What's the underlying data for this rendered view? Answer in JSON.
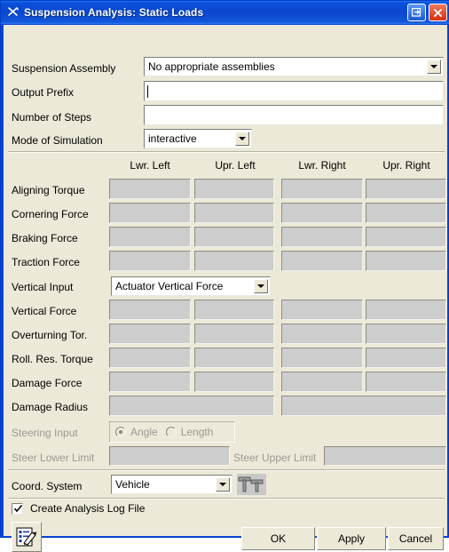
{
  "window": {
    "title": "Suspension Analysis: Static Loads",
    "app_icon": "scissors-icon",
    "buttons": [
      {
        "name": "restore-button",
        "icon": "restore-icon"
      },
      {
        "name": "close-button",
        "icon": "close-icon"
      }
    ],
    "titlebar_color": "#0a46cd",
    "client_color": "#ece9d8"
  },
  "form": {
    "suspension_assembly": {
      "label": "Suspension Assembly",
      "value": "No appropriate assemblies"
    },
    "output_prefix": {
      "label": "Output Prefix",
      "value": ""
    },
    "number_of_steps": {
      "label": "Number of Steps",
      "value": ""
    },
    "mode_of_simulation": {
      "label": "Mode of Simulation",
      "value": "interactive"
    }
  },
  "table": {
    "columns": [
      "Lwr. Left",
      "Upr. Left",
      "Lwr. Right",
      "Upr. Right"
    ],
    "rows": [
      {
        "label": "Aligning Torque",
        "values": [
          "",
          "",
          "",
          ""
        ]
      },
      {
        "label": "Cornering Force",
        "values": [
          "",
          "",
          "",
          ""
        ]
      },
      {
        "label": "Braking Force",
        "values": [
          "",
          "",
          "",
          ""
        ]
      },
      {
        "label": "Traction Force",
        "values": [
          "",
          "",
          "",
          ""
        ]
      },
      {
        "label": "Vertical Force",
        "values": [
          "",
          "",
          "",
          ""
        ]
      },
      {
        "label": "Overturning Tor.",
        "values": [
          "",
          "",
          "",
          ""
        ]
      },
      {
        "label": "Roll. Res. Torque",
        "values": [
          "",
          "",
          "",
          ""
        ]
      },
      {
        "label": "Damage Force",
        "values": [
          "",
          "",
          "",
          ""
        ]
      },
      {
        "label": "Damage Radius",
        "values": [
          "",
          ""
        ]
      }
    ]
  },
  "vertical_input": {
    "label": "Vertical Input",
    "value": "Actuator Vertical Force"
  },
  "steering": {
    "label": "Steering Input",
    "options": [
      {
        "label": "Angle",
        "selected": true
      },
      {
        "label": "Length",
        "selected": false
      }
    ],
    "lower_limit": {
      "label": "Steer Lower Limit",
      "value": ""
    },
    "upper_limit": {
      "label": "Steer Upper Limit",
      "value": ""
    }
  },
  "coord_system": {
    "label": "Coord. System",
    "value": "Vehicle",
    "picker_icon": "coordinate-picker-icon"
  },
  "log_file": {
    "label": "Create Analysis Log File",
    "checked": true
  },
  "footer": {
    "notes_icon": "edit-notes-icon",
    "ok": "OK",
    "apply": "Apply",
    "cancel": "Cancel"
  }
}
